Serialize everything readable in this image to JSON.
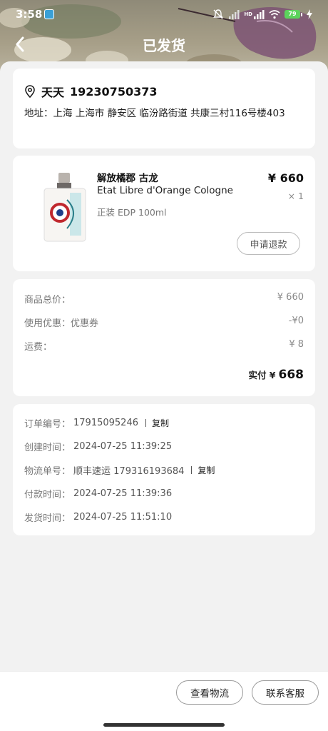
{
  "status_bar": {
    "time": "3:58",
    "battery": "79",
    "network_label": "HD"
  },
  "nav": {
    "title": "已发货",
    "back_icon": "chevron-left-icon"
  },
  "address": {
    "icon": "location-pin-icon",
    "name": "天天",
    "phone": "19230750373",
    "full": "地址：上海 上海市 静安区 临汾路街道 共康三村116号楼403"
  },
  "product": {
    "name_cn": "解放橘郡 古龙",
    "name_en": "Etat Libre d'Orange Cologne",
    "spec": "正装 EDP 100ml",
    "price": "¥ 660",
    "qty": "× 1",
    "refund_label": "申请退款"
  },
  "price_summary": {
    "rows": [
      {
        "label": "商品总价：",
        "value": "¥ 660"
      },
      {
        "label": "使用优惠：优惠券",
        "value": "-¥0"
      },
      {
        "label": "运费：",
        "value": "¥ 8"
      }
    ],
    "paid_label": "实付 ¥",
    "paid_value": "668"
  },
  "order_info": {
    "rows": [
      {
        "label": "订单编号：",
        "value": "17915095246",
        "copy": "复制"
      },
      {
        "label": "创建时间：",
        "value": "2024-07-25 11:39:25"
      },
      {
        "label": "物流单号：",
        "value": "顺丰速运 179316193684",
        "copy": "复制"
      },
      {
        "label": "付款时间：",
        "value": "2024-07-25 11:39:36"
      },
      {
        "label": "发货时间：",
        "value": "2024-07-25 11:51:10"
      }
    ]
  },
  "bottom_bar": {
    "logistics_label": "查看物流",
    "service_label": "联系客服"
  },
  "colors": {
    "background": "#f2f2f2",
    "card": "#ffffff",
    "text_primary": "#111111",
    "text_secondary": "#777777",
    "battery": "#5cd35c"
  }
}
